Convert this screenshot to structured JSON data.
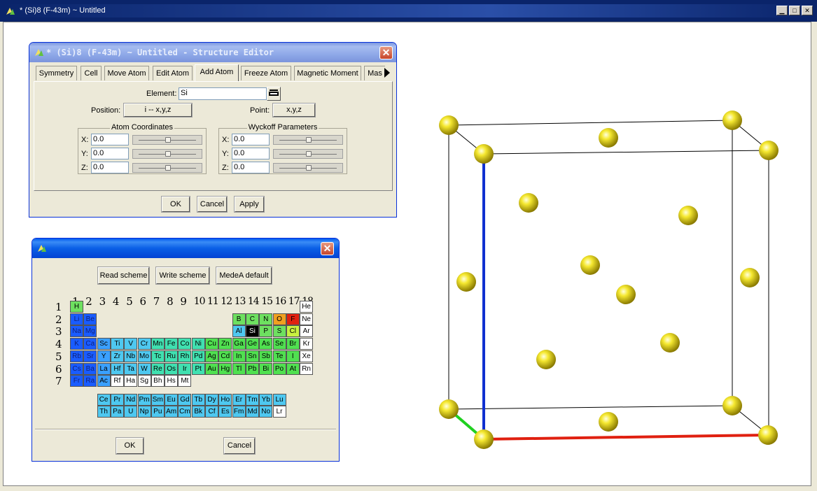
{
  "main_window": {
    "title": "* (Si)8  (F-43m) ~ Untitled",
    "buttons": [
      "minimize",
      "maximize",
      "close"
    ]
  },
  "structure_editor": {
    "title": "* (Si)8  (F-43m) ~ Untitled - Structure Editor",
    "tabs": [
      "Symmetry",
      "Cell",
      "Move Atom",
      "Edit Atom",
      "Add Atom",
      "Freeze Atom",
      "Magnetic Moment",
      "Mas"
    ],
    "active_tab": "Add Atom",
    "element_label": "Element:",
    "element_value": "Si",
    "position_label": "Position:",
    "position_button": "i -- x,y,z",
    "point_label": "Point:",
    "point_button": "x,y,z",
    "atom_coords": {
      "title": "Atom Coordinates",
      "x_label": "X:",
      "y_label": "Y:",
      "z_label": "Z:",
      "x": "0.0",
      "y": "0.0",
      "z": "0.0"
    },
    "wyckoff": {
      "title": "Wyckoff Parameters",
      "x_label": "X:",
      "y_label": "Y:",
      "z_label": "Z:",
      "x": "0.0",
      "y": "0.0",
      "z": "0.0"
    },
    "ok": "OK",
    "cancel": "Cancel",
    "apply": "Apply"
  },
  "periodic_dialog": {
    "read_scheme": "Read scheme",
    "write_scheme": "Write scheme",
    "default": "MedeA default",
    "groups": [
      "1",
      "2",
      "3",
      "4",
      "5",
      "6",
      "7",
      "8",
      "9",
      "10",
      "11",
      "12",
      "13",
      "14",
      "15",
      "16",
      "17",
      "18"
    ],
    "periods": [
      "1",
      "2",
      "3",
      "4",
      "5",
      "6",
      "7"
    ],
    "rows": [
      [
        "H",
        "",
        "",
        "",
        "",
        "",
        "",
        "",
        "",
        "",
        "",
        "",
        "",
        "",
        "",
        "",
        "",
        "He"
      ],
      [
        "Li",
        "Be",
        "",
        "",
        "",
        "",
        "",
        "",
        "",
        "",
        "",
        "",
        "B",
        "C",
        "N",
        "O",
        "F",
        "Ne"
      ],
      [
        "Na",
        "Mg",
        "",
        "",
        "",
        "",
        "",
        "",
        "",
        "",
        "",
        "",
        "Al",
        "Si",
        "P",
        "S",
        "Cl",
        "Ar"
      ],
      [
        "K",
        "Ca",
        "Sc",
        "Ti",
        "V",
        "Cr",
        "Mn",
        "Fe",
        "Co",
        "Ni",
        "Cu",
        "Zn",
        "Ga",
        "Ge",
        "As",
        "Se",
        "Br",
        "Kr"
      ],
      [
        "Rb",
        "Sr",
        "Y",
        "Zr",
        "Nb",
        "Mo",
        "Tc",
        "Ru",
        "Rh",
        "Pd",
        "Ag",
        "Cd",
        "In",
        "Sn",
        "Sb",
        "Te",
        "I",
        "Xe"
      ],
      [
        "Cs",
        "Ba",
        "La",
        "Hf",
        "Ta",
        "W",
        "Re",
        "Os",
        "Ir",
        "Pt",
        "Au",
        "Hg",
        "Tl",
        "Pb",
        "Bi",
        "Po",
        "At",
        "Rn"
      ],
      [
        "Fr",
        "Ra",
        "Ac",
        "Rf",
        "Ha",
        "Sg",
        "Bh",
        "Hs",
        "Mt",
        "",
        "",
        "",
        "",
        "",
        "",
        "",
        "",
        ""
      ]
    ],
    "lanthanides": [
      "Ce",
      "Pr",
      "Nd",
      "Pm",
      "Sm",
      "Eu",
      "Gd",
      "Tb",
      "Dy",
      "Ho",
      "Er",
      "Tm",
      "Yb",
      "Lu"
    ],
    "actinides": [
      "Th",
      "Pa",
      "U",
      "Np",
      "Pu",
      "Am",
      "Cm",
      "Bk",
      "Cf",
      "Es",
      "Fm",
      "Md",
      "No",
      "Lr"
    ],
    "selected_element": "Si",
    "ok": "OK",
    "cancel": "Cancel"
  },
  "colors": {
    "atom": "#f0e020",
    "axis_a": "#e02010",
    "axis_b": "#20d020",
    "axis_c": "#1030d0",
    "alkali": "#1a5cff",
    "transition_early": "#3aa0ff",
    "transition_mid": "#40e0b0",
    "post": "#50e050",
    "light_blue": "#4ec8f0",
    "nonmetal_green": "#6ee060",
    "oxygen": "#f0a020",
    "fluorine": "#e02010",
    "chlorine": "#c8f040",
    "selected": "#000000",
    "empty": "#ffffff"
  }
}
